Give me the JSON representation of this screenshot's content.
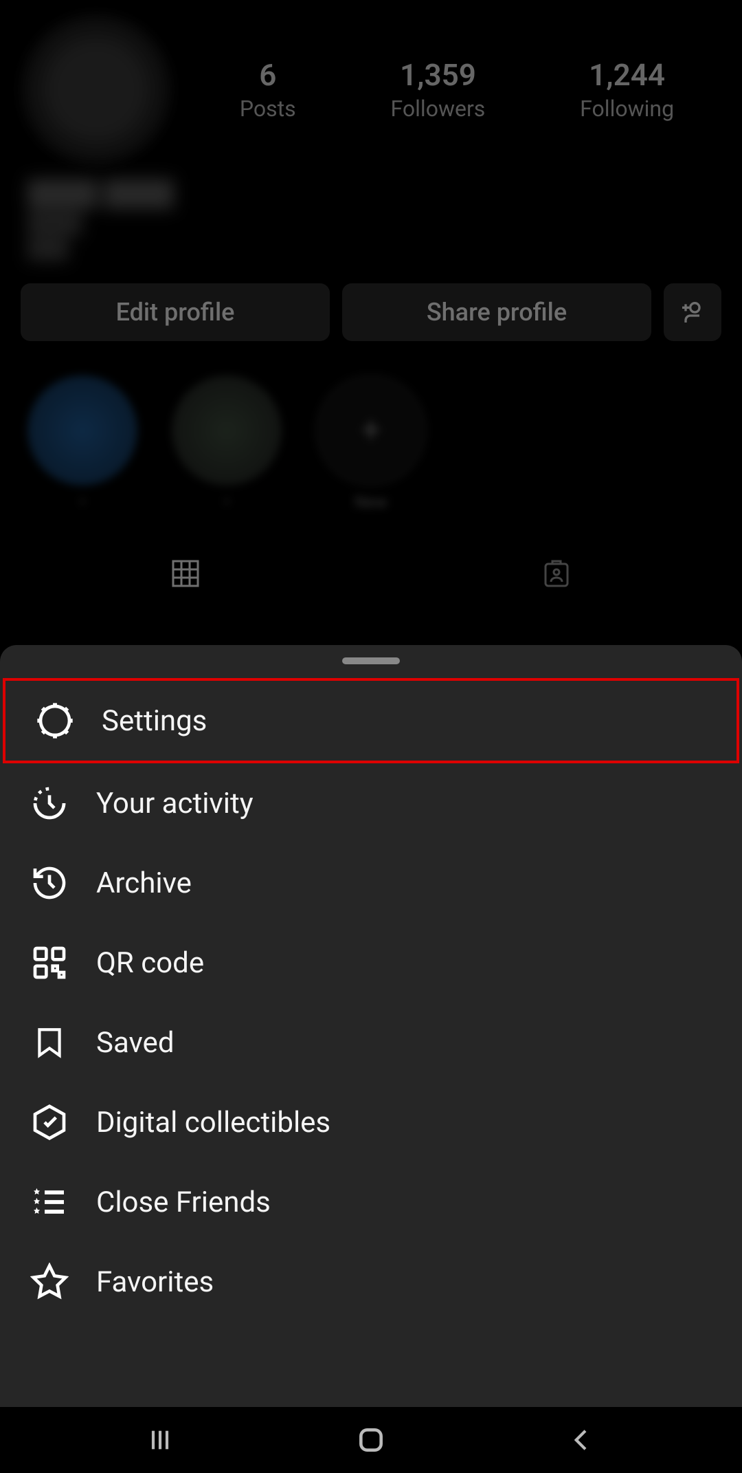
{
  "profile": {
    "stats": {
      "posts_count": "6",
      "posts_label": "Posts",
      "followers_count": "1,359",
      "followers_label": "Followers",
      "following_count": "1,244",
      "following_label": "Following"
    },
    "actions": {
      "edit_label": "Edit profile",
      "share_label": "Share profile"
    },
    "highlights": {
      "new_label": "New"
    }
  },
  "menu": {
    "items": [
      {
        "label": "Settings",
        "icon": "settings-icon",
        "highlighted": true
      },
      {
        "label": "Your activity",
        "icon": "activity-icon"
      },
      {
        "label": "Archive",
        "icon": "archive-icon"
      },
      {
        "label": "QR code",
        "icon": "qrcode-icon"
      },
      {
        "label": "Saved",
        "icon": "saved-icon"
      },
      {
        "label": "Digital collectibles",
        "icon": "collectibles-icon"
      },
      {
        "label": "Close Friends",
        "icon": "closefriends-icon"
      },
      {
        "label": "Favorites",
        "icon": "favorites-icon"
      }
    ]
  }
}
